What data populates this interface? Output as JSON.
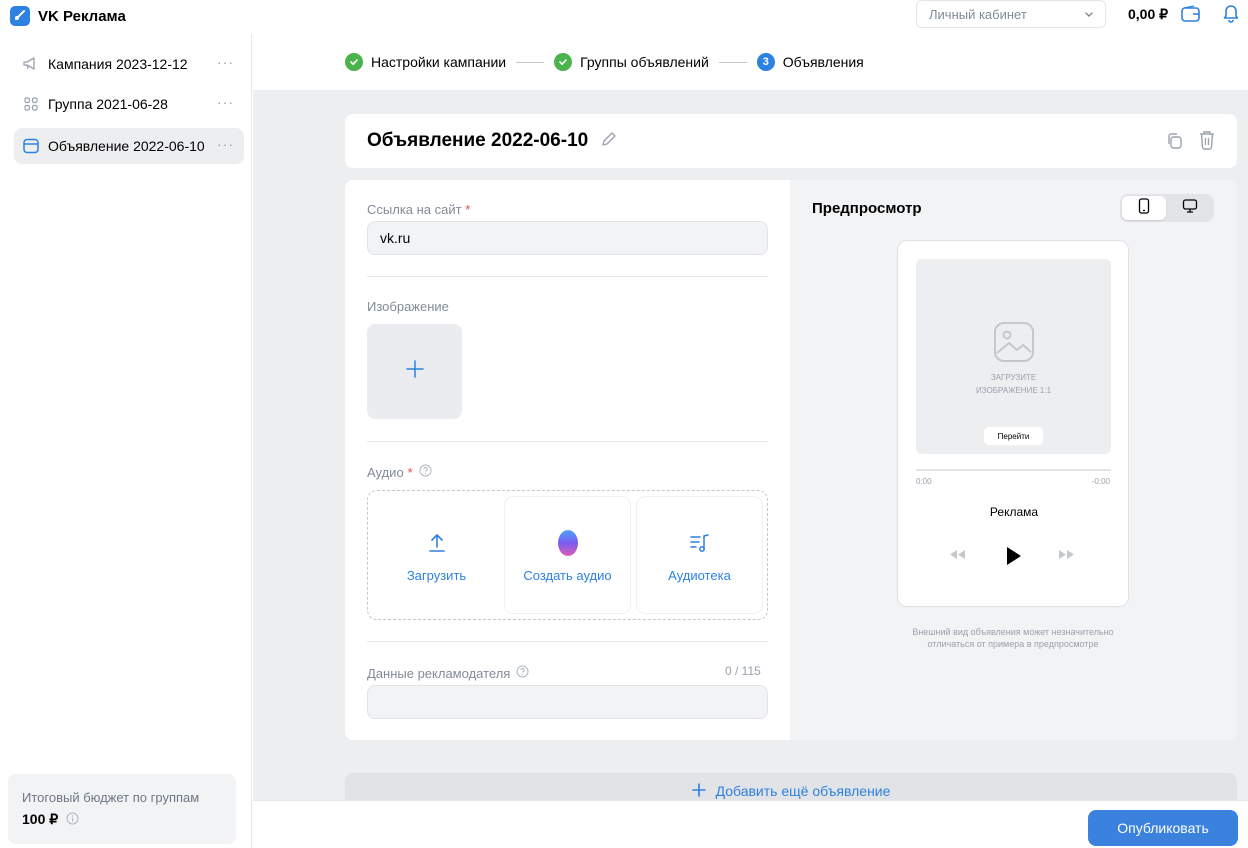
{
  "app": {
    "title": "VK Реклама"
  },
  "header": {
    "account_select": "Личный кабинет",
    "balance": "0,00 ₽"
  },
  "sidebar": {
    "items": [
      {
        "label": "Кампания 2023-12-12",
        "more": "···"
      },
      {
        "label": "Группа 2021-06-28",
        "more": "···"
      },
      {
        "label": "Объявление 2022-06-10",
        "more": "···"
      }
    ],
    "budget": {
      "label": "Итоговый бюджет по группам",
      "value": "100 ₽"
    }
  },
  "stepper": {
    "steps": [
      {
        "label": "Настройки кампании",
        "state": "done"
      },
      {
        "label": "Группы объявлений",
        "state": "done"
      },
      {
        "label": "Объявления",
        "state": "current",
        "number": "3"
      }
    ]
  },
  "ad": {
    "title": "Объявление 2022-06-10",
    "link_label": "Ссылка на сайт",
    "required_mark": "*",
    "link_value": "vk.ru",
    "image_label": "Изображение",
    "audio_label": "Аудио",
    "audio_options": [
      {
        "label": "Загрузить",
        "icon": "upload-icon"
      },
      {
        "label": "Создать аудио",
        "icon": "ai-orb-icon"
      },
      {
        "label": "Аудиотека",
        "icon": "music-list-icon"
      }
    ],
    "advertiser_label": "Данные рекламодателя",
    "advertiser_counter": "0 / 115",
    "advertiser_value": ""
  },
  "preview": {
    "title": "Предпросмотр",
    "image_hint_line1": "Загрузите",
    "image_hint_line2": "изображение 1:1",
    "go_button": "Перейти",
    "time_start": "0:00",
    "time_end": "-0:00",
    "track_title": "Реклама",
    "note_line1": "Внешний вид объявления может незначительно",
    "note_line2": "отличаться от примера в предпросмотре"
  },
  "actions": {
    "add_more": "Добавить ещё объявление",
    "publish": "Опубликовать"
  },
  "colors": {
    "accent": "#2d81e0",
    "success": "#4bb34b",
    "background": "#edeef0"
  }
}
